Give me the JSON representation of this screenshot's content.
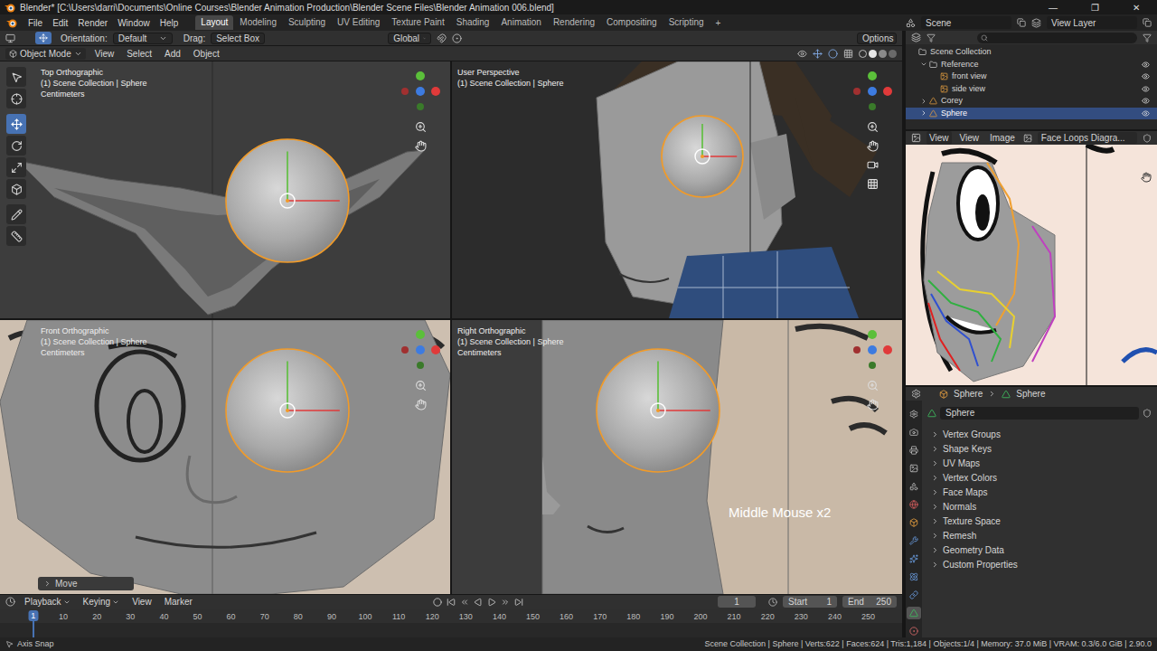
{
  "window": {
    "title": "Blender* [C:\\Users\\darri\\Documents\\Online Courses\\Blender Animation Production\\Blender Scene Files\\Blender Animation 006.blend]",
    "controls": [
      "—",
      "❐",
      "✕"
    ]
  },
  "menu": [
    "File",
    "Edit",
    "Render",
    "Window",
    "Help"
  ],
  "workspaces": [
    {
      "label": "Layout",
      "selected": true
    },
    {
      "label": "Modeling",
      "selected": false
    },
    {
      "label": "Sculpting",
      "selected": false
    },
    {
      "label": "UV Editing",
      "selected": false
    },
    {
      "label": "Texture Paint",
      "selected": false
    },
    {
      "label": "Shading",
      "selected": false
    },
    {
      "label": "Animation",
      "selected": false
    },
    {
      "label": "Rendering",
      "selected": false
    },
    {
      "label": "Compositing",
      "selected": false
    },
    {
      "label": "Scripting",
      "selected": false
    }
  ],
  "add_workspace": "+",
  "scene": {
    "scene": "Scene",
    "view_layer": "View Layer"
  },
  "tool_header": {
    "orientation_label": "Orientation:",
    "orientation": "Default",
    "drag_label": "Drag:",
    "drag": "Select Box",
    "transform": "Global",
    "options": "Options"
  },
  "viewport_header": {
    "mode": "Object Mode",
    "menus": [
      "View",
      "Select",
      "Add",
      "Object"
    ]
  },
  "tools": [
    {
      "selected": false
    },
    {
      "selected": false
    },
    {
      "selected": true
    },
    {
      "selected": false
    },
    {
      "selected": false
    },
    {
      "selected": false
    },
    {
      "selected": false
    },
    {
      "selected": false
    }
  ],
  "viewports": [
    {
      "kind": "top",
      "name": "Top Orthographic",
      "collection": "(1) Scene Collection | Sphere",
      "units": "Centimeters"
    },
    {
      "kind": "perspective",
      "name": "User Perspective",
      "collection": "(1) Scene Collection | Sphere"
    },
    {
      "kind": "front",
      "name": "Front Orthographic",
      "collection": "(1) Scene Collection | Sphere",
      "units": "Centimeters"
    },
    {
      "kind": "right",
      "name": "Right Orthographic",
      "collection": "(1) Scene Collection | Sphere",
      "units": "Centimeters"
    }
  ],
  "overlay": "Middle Mouse x2",
  "operator_panel": {
    "label": "Move",
    "expanded": false
  },
  "outliner": {
    "items": [
      {
        "label": "Scene Collection",
        "depth": 0,
        "kind": "scene",
        "selected": false
      },
      {
        "label": "Reference",
        "depth": 1,
        "kind": "collection",
        "selected": false,
        "expanded": true,
        "visible": true
      },
      {
        "label": "front view",
        "depth": 2,
        "kind": "image",
        "selected": false,
        "visible": true
      },
      {
        "label": "side view",
        "depth": 2,
        "kind": "image",
        "selected": false,
        "visible": true
      },
      {
        "label": "Corey",
        "depth": 1,
        "kind": "object",
        "selected": false,
        "expanded": false,
        "visible": true
      },
      {
        "label": "Sphere",
        "depth": 1,
        "kind": "object",
        "selected": true,
        "expanded": false,
        "visible": true
      }
    ]
  },
  "image_editor": {
    "menus": [
      "View",
      "View",
      "Image"
    ],
    "image": "Face Loops Diagra..."
  },
  "properties": {
    "object": "Sphere",
    "data": "Sphere",
    "datablock": "Sphere",
    "tabs": [
      {
        "selected": false
      },
      {
        "selected": false
      },
      {
        "selected": false
      },
      {
        "selected": false
      },
      {
        "selected": false
      },
      {
        "selected": false
      },
      {
        "selected": false
      },
      {
        "selected": false
      },
      {
        "selected": false
      },
      {
        "selected": false
      },
      {
        "selected": false
      },
      {
        "selected": true
      },
      {
        "selected": false
      }
    ],
    "panels": [
      {
        "label": "Vertex Groups",
        "expanded": false
      },
      {
        "label": "Shape Keys",
        "expanded": false
      },
      {
        "label": "UV Maps",
        "expanded": false
      },
      {
        "label": "Vertex Colors",
        "expanded": false
      },
      {
        "label": "Face Maps",
        "expanded": false
      },
      {
        "label": "Normals",
        "expanded": false
      },
      {
        "label": "Texture Space",
        "expanded": false
      },
      {
        "label": "Remesh",
        "expanded": false
      },
      {
        "label": "Geometry Data",
        "expanded": false
      },
      {
        "label": "Custom Properties",
        "expanded": false
      }
    ]
  },
  "timeline": {
    "menus": [
      "Playback",
      "Keying",
      "View",
      "Marker"
    ],
    "frame": "1",
    "start_label": "Start",
    "start": "1",
    "end_label": "End",
    "end": "250",
    "current": "1",
    "ticks": [
      "10",
      "20",
      "30",
      "40",
      "50",
      "60",
      "70",
      "80",
      "90",
      "100",
      "110",
      "120",
      "130",
      "140",
      "150",
      "160",
      "170",
      "180",
      "190",
      "200",
      "210",
      "220",
      "230",
      "240",
      "250"
    ]
  },
  "status": {
    "left": "Axis Snap",
    "right": "Scene Collection | Sphere | Verts:622 | Faces:624 | Tris:1,184 | Objects:1/4 | Memory: 37.0 MiB | VRAM: 0.3/6.0 GiB | 2.90.0"
  }
}
